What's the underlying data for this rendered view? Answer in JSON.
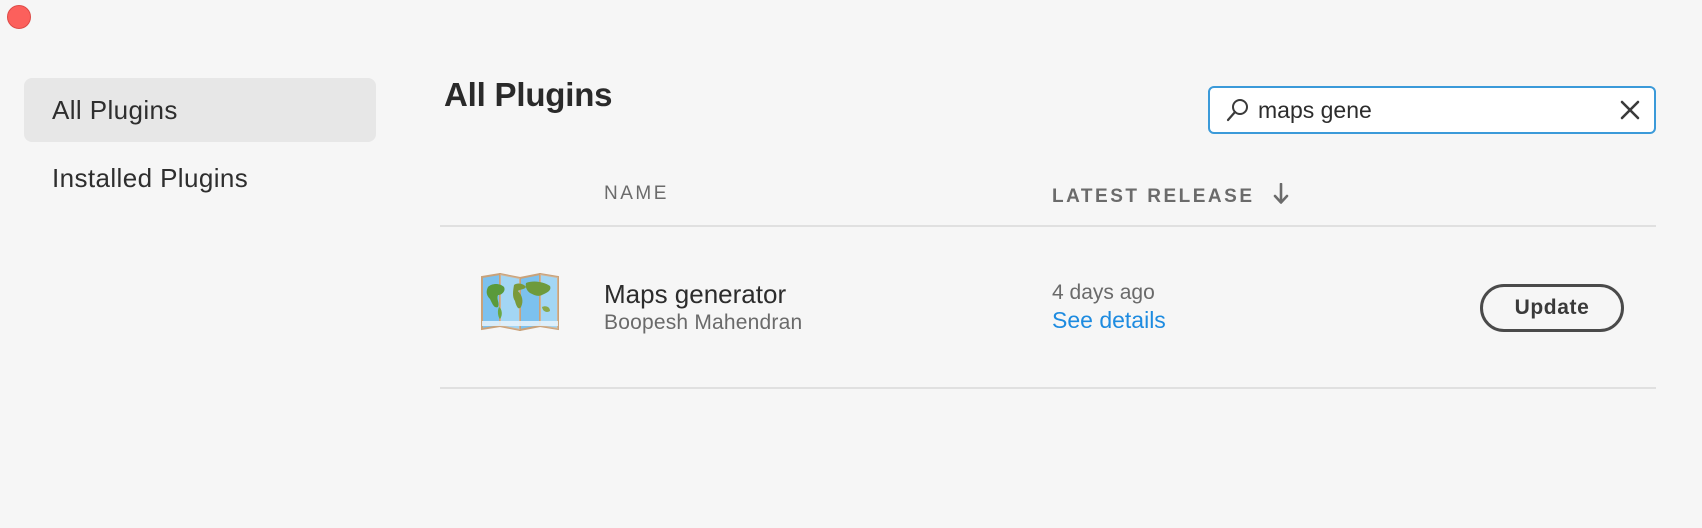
{
  "window": {
    "close_button": "close-dot"
  },
  "sidebar": {
    "items": [
      {
        "label": "All Plugins",
        "active": true
      },
      {
        "label": "Installed Plugins",
        "active": false
      }
    ]
  },
  "main": {
    "title": "All Plugins",
    "search": {
      "value": "maps gene",
      "placeholder": ""
    },
    "table": {
      "columns": {
        "name": "NAME",
        "latest_release": "LATEST RELEASE"
      },
      "sort": {
        "column": "latest_release",
        "direction": "descending",
        "icon": "arrow-down-icon"
      },
      "rows": [
        {
          "icon": "world-map-icon",
          "name": "Maps generator",
          "author": "Boopesh Mahendran",
          "release": "4 days ago",
          "details_link": "See details",
          "action_label": "Update"
        }
      ]
    }
  },
  "colors": {
    "accent": "#3b9ad9",
    "link": "#1d8be0",
    "close": "#fc605c",
    "sidebar_active": "#e7e7e7"
  }
}
